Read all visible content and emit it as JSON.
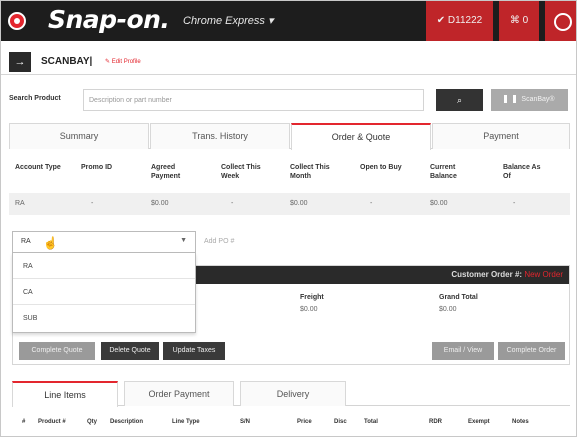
{
  "brand": {
    "logo": "Snap-on.",
    "product": "Chrome Express ▾"
  },
  "topbar": {
    "user_id": "✔ D11222",
    "cart_count": "⌘ 0",
    "icons": [
      "brand-circle-icon",
      "user-icon",
      "cart-icon",
      "clock-icon"
    ]
  },
  "customer": {
    "name": "SCANBAY|",
    "edit_label": "✎ Edit Profile"
  },
  "search": {
    "label": "Search Product",
    "placeholder": "Description or part number",
    "search_icon": "⌕",
    "scanbay_label": "ScanBay®"
  },
  "tabs": [
    "Summary",
    "Trans. History",
    "Order & Quote",
    "Payment"
  ],
  "active_tab": "Order & Quote",
  "account": {
    "headers": [
      "Account Type",
      "Promo ID",
      "Agreed\nPayment",
      "Collect This\nWeek",
      "Collect This\nMonth",
      "Open to Buy",
      "Current\nBalance",
      "Balance As\nOf"
    ],
    "row": [
      "RA",
      "-",
      "$0.00",
      "-",
      "$0.00",
      "-",
      "$0.00",
      "-"
    ]
  },
  "order": {
    "account_select_value": "RA",
    "account_options": [
      "RA",
      "CA",
      "SUB"
    ],
    "add_po_label": "Add PO #",
    "customer_order_label": "Customer Order #:",
    "customer_order_value": "New Order",
    "freight_label": "Freight",
    "freight_value": "$0.00",
    "grand_total_label": "Grand Total",
    "grand_total_value": "$0.00",
    "buttons": {
      "complete_quote": "Complete Quote",
      "delete_quote": "Delete Quote",
      "update_taxes": "Update Taxes",
      "email_view": "Email / View",
      "complete_order": "Complete Order"
    }
  },
  "lower_tabs": [
    "Line Items",
    "Order Payment",
    "Delivery"
  ],
  "line_item_columns": [
    "#",
    "Product #",
    "Qty",
    "Description",
    "Line Type",
    "S/N",
    "Price",
    "Disc",
    "Total",
    "RDR",
    "Exempt",
    "Notes"
  ],
  "colors": {
    "brand_red": "#e3262e",
    "dark": "#1d1d1d",
    "header_red": "#bf2529"
  }
}
